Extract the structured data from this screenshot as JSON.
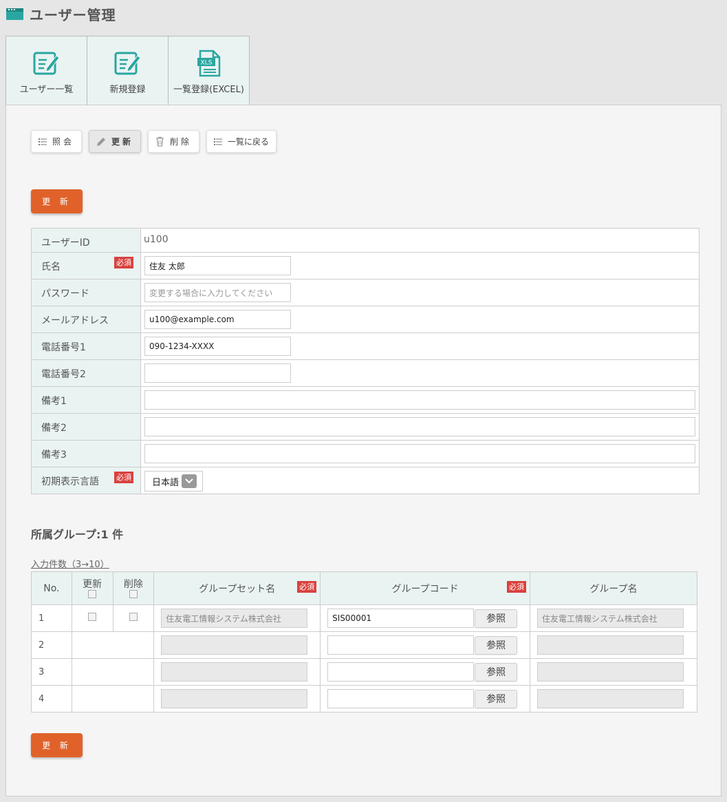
{
  "page": {
    "title": "ユーザー管理"
  },
  "tabs": [
    {
      "label": "ユーザー一覧",
      "icon": "edit-list-icon"
    },
    {
      "label": "新規登録",
      "icon": "edit-list-icon"
    },
    {
      "label": "一覧登録(EXCEL)",
      "icon": "xls-file-icon",
      "icon_text": "XLS"
    }
  ],
  "actions": {
    "view": "照会",
    "update": "更新",
    "delete": "削除",
    "back": "一覧に戻る"
  },
  "submit_label": "更 新",
  "form": {
    "required_label": "必須",
    "user_id": {
      "label": "ユーザーID",
      "value": "u100"
    },
    "name": {
      "label": "氏名",
      "value": "住友 太郎"
    },
    "password": {
      "label": "パスワード",
      "placeholder": "変更する場合に入力してください"
    },
    "email": {
      "label": "メールアドレス",
      "value": "u100@example.com"
    },
    "phone1": {
      "label": "電話番号1",
      "value": "090-1234-XXXX"
    },
    "phone2": {
      "label": "電話番号2",
      "value": ""
    },
    "note1": {
      "label": "備考1",
      "value": ""
    },
    "note2": {
      "label": "備考2",
      "value": ""
    },
    "note3": {
      "label": "備考3",
      "value": ""
    },
    "language": {
      "label": "初期表示言語",
      "value": "日本語"
    }
  },
  "groups": {
    "title": "所属グループ:1 件",
    "input_count": "入力件数（3→10）",
    "headers": {
      "no": "No.",
      "update": "更新",
      "delete": "削除",
      "group_set": "グループセット名",
      "group_code": "グループコード",
      "group_name": "グループ名"
    },
    "ref_label": "参照",
    "rows": [
      {
        "no": "1",
        "group_set": "住友電工情報システム株式会社",
        "group_code": "SIS00001",
        "group_name": "住友電工情報システム株式会社"
      },
      {
        "no": "2",
        "group_set": "",
        "group_code": "",
        "group_name": ""
      },
      {
        "no": "3",
        "group_set": "",
        "group_code": "",
        "group_name": ""
      },
      {
        "no": "4",
        "group_set": "",
        "group_code": "",
        "group_name": ""
      }
    ]
  },
  "colors": {
    "accent": "#2aa6a0",
    "button": "#e0622a",
    "required": "#d9413e",
    "label_bg": "#e9f3f2"
  }
}
